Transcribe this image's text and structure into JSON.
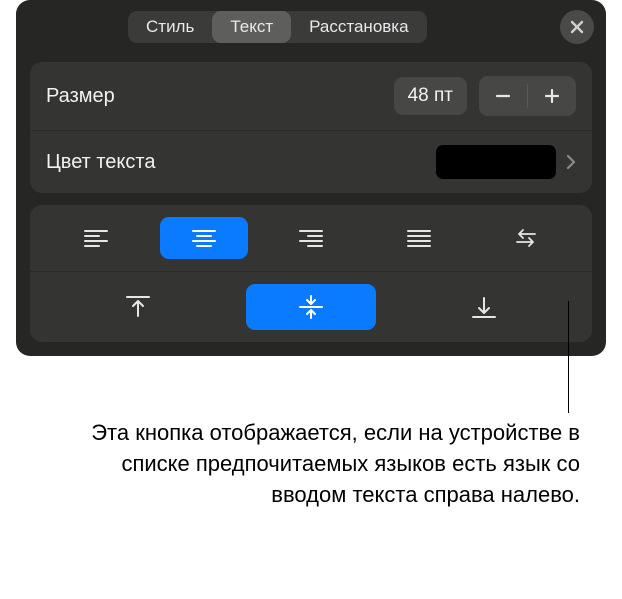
{
  "tabs": {
    "style": "Стиль",
    "text": "Текст",
    "arrangement": "Расстановка"
  },
  "size": {
    "label": "Размер",
    "value": "48 пт"
  },
  "text_color": {
    "label": "Цвет текста",
    "swatch": "#000000"
  },
  "caption": "Эта кнопка отображается, если на устройстве в списке предпочитаемых языков есть язык со вводом текста справа налево."
}
